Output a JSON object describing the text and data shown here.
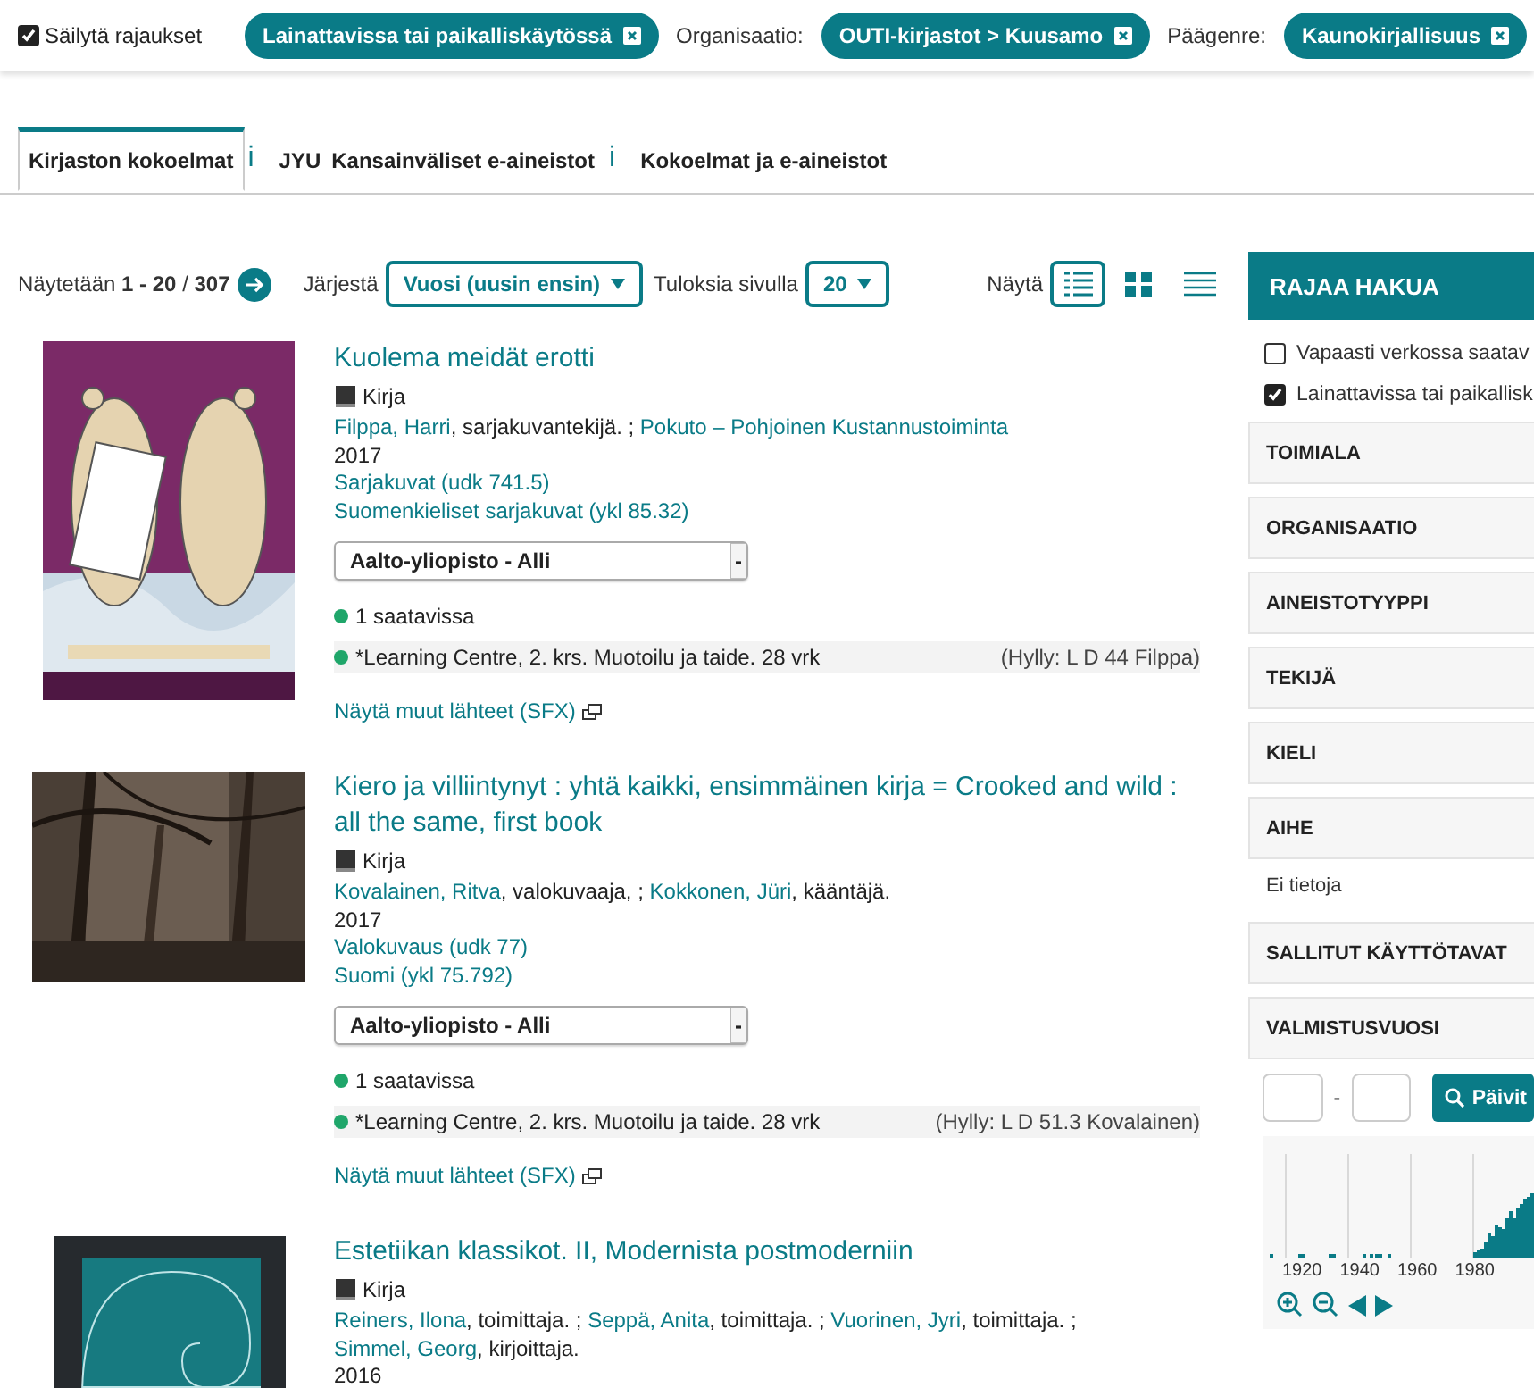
{
  "filter_bar": {
    "keep_filters": {
      "label": "Säilytä rajaukset",
      "checked": true
    },
    "chips": [
      {
        "value": "Lainattavissa tai paikalliskäytössä"
      },
      {
        "label": "Organisaatio:",
        "value": "OUTI-kirjastot > Kuusamo"
      },
      {
        "label": "Päägenre:",
        "value": "Kaunokirjallisuus"
      }
    ]
  },
  "tabs": [
    {
      "label": "Kirjaston kokoelmat",
      "info": "i",
      "selected": true
    },
    {
      "prefix": "JYU",
      "label": "Kansainväliset e-aineistot",
      "info": "i",
      "selected": false
    },
    {
      "label": "Kokoelmat ja e-aineistot",
      "selected": false
    }
  ],
  "results_bar": {
    "showing": "Näytetään **1 - 20** / **307**",
    "sort_label": "Järjestä",
    "sort_value": "Vuosi (uusin ensin)",
    "per_page_label": "Tuloksia sivulla",
    "per_page_value": "20",
    "view_label": "Näytä",
    "view_modes": [
      {
        "kind": "list",
        "selected": true
      },
      {
        "kind": "grid",
        "selected": false
      },
      {
        "kind": "compact",
        "selected": false
      }
    ]
  },
  "records": [
    {
      "title": "Kuolema meidät erotti",
      "format": "Kirja",
      "authors": [
        {
          "name": "Filppa, Harri",
          "role": ", sarjakuvantekijä. ; "
        },
        {
          "name": "Pokuto – Pohjoinen Kustannustoiminta"
        }
      ],
      "year": "2017",
      "subjects": [
        "Sarjakuvat (udk 741.5)",
        "Suomenkieliset sarjakuvat (ykl 85.32)"
      ],
      "location": "Aalto-yliopisto - Alli",
      "availability": "1 saatavissa",
      "holding": "*Learning Centre, 2. krs. Muotoilu ja taide. 28 vrk",
      "shelf": "(Hylly: L D 44 Filppa)",
      "link": "Näytä muut lähteet (SFX)"
    },
    {
      "title": "Kiero ja villiintynyt : yhtä kaikki, ensimmäinen kirja = Crooked and wild : all the same, first book",
      "format": "Kirja",
      "authors": [
        {
          "name": "Kovalainen, Ritva",
          "role": ", valokuvaaja, ; "
        },
        {
          "name": "Kokkonen, Jüri",
          "role": ", kääntäjä."
        }
      ],
      "year": "2017",
      "subjects": [
        "Valokuvaus (udk 77)",
        "Suomi (ykl 75.792)"
      ],
      "location": "Aalto-yliopisto - Alli",
      "availability": "1 saatavissa",
      "holding": "*Learning Centre, 2. krs. Muotoilu ja taide. 28 vrk",
      "shelf": "(Hylly: L D 51.3 Kovalainen)",
      "link": "Näytä muut lähteet (SFX)"
    },
    {
      "title": "Estetiikan klassikot. II, Modernista postmoderniin",
      "format": "Kirja",
      "authors": [
        {
          "name": "Reiners, Ilona",
          "role": ", toimittaja. ; "
        },
        {
          "name": "Seppä, Anita",
          "role": ", toimittaja. ; "
        },
        {
          "name": "Vuorinen, Jyri",
          "role": ", toimittaja. ; "
        },
        {
          "name": "Simmel, Georg",
          "role": ", kirjoittaja."
        }
      ],
      "year": "2016"
    }
  ],
  "sidebar": {
    "title": "RAJAA HAKUA",
    "checkboxes": [
      {
        "label": "Vapaasti verkossa saatav",
        "checked": false
      },
      {
        "label": "Lainattavissa tai paikallisk",
        "checked": true
      }
    ],
    "facets": [
      {
        "title": "TOIMIALA"
      },
      {
        "title": "ORGANISAATIO"
      },
      {
        "title": "AINEISTOTYYPPI"
      },
      {
        "title": "TEKIJÄ"
      },
      {
        "title": "KIELI"
      },
      {
        "title": "AIHE",
        "note": "Ei tietoja"
      },
      {
        "title": "SALLITUT KÄYTTÖTAVAT"
      },
      {
        "title": "VALMISTUSVUOSI"
      }
    ],
    "year_range": {
      "separator": "-",
      "button": "Päivit",
      "axis_labels": [
        "1920",
        "1940",
        "1960",
        "1980"
      ]
    }
  }
}
